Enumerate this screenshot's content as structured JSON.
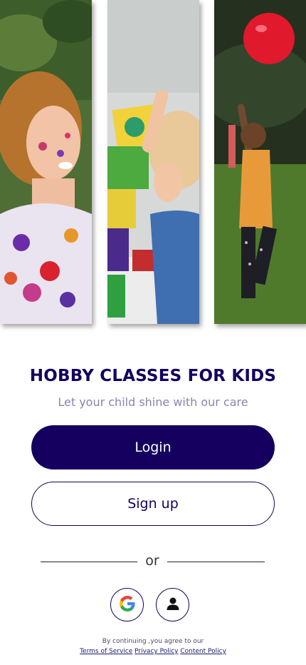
{
  "hero": {
    "photos": [
      {
        "name": "girl-with-paint-photo"
      },
      {
        "name": "toddler-with-blocks-photo"
      },
      {
        "name": "girl-with-balloon-photo"
      }
    ]
  },
  "title": "HOBBY CLASSES FOR KIDS",
  "subtitle": "Let your child shine with our care",
  "buttons": {
    "login": "Login",
    "signup": "Sign up"
  },
  "divider_text": "or",
  "social": {
    "google_icon": "google-icon",
    "guest_icon": "person-icon"
  },
  "legal": {
    "notice": "By continuing ,you agree to our",
    "terms": "Terms of Service",
    "privacy": "Privacy Policy",
    "content": "Content Policy"
  },
  "colors": {
    "primary": "#15005f",
    "subtitle": "#8a83b0"
  }
}
